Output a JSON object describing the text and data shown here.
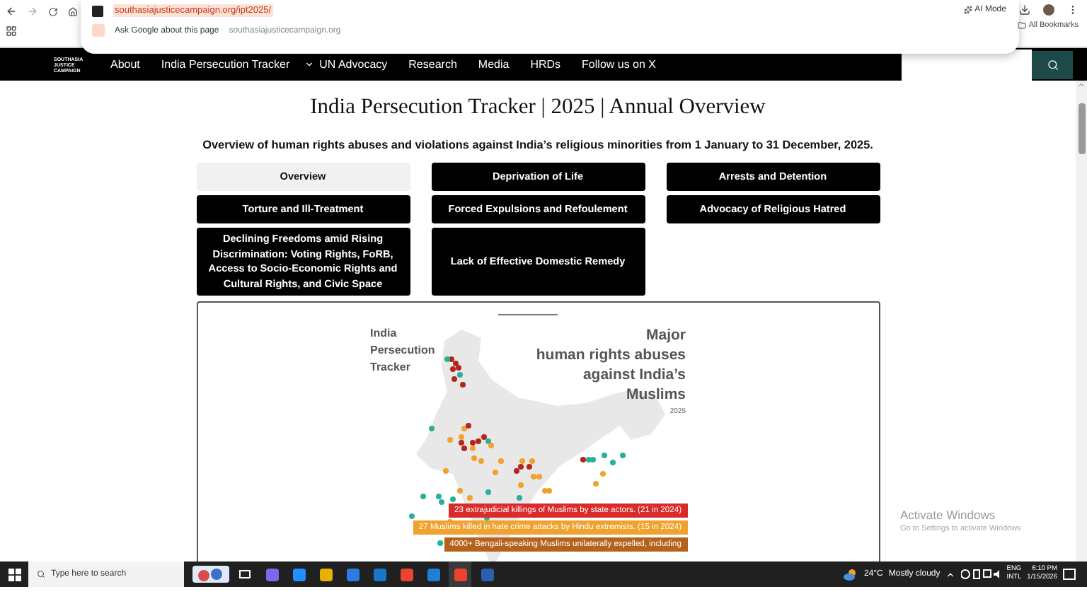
{
  "browser": {
    "url": "southasiajusticecampaign.org/ipt2025/",
    "suggestion": "Ask Google about this page",
    "suggestion_site": "southasiajusticecampaign.org",
    "ai_mode": "AI Mode",
    "bookmarks": "All Bookmarks"
  },
  "nav": {
    "logo_lines": [
      "SOUTHASIA",
      "JUSTICE",
      "CAMPAIGN"
    ],
    "items": [
      {
        "label": "About",
        "has_menu": false
      },
      {
        "label": "India Persecution Tracker",
        "has_menu": true
      },
      {
        "label": "UN Advocacy",
        "has_menu": false
      },
      {
        "label": "Research",
        "has_menu": false
      },
      {
        "label": "Media",
        "has_menu": false
      },
      {
        "label": "HRDs",
        "has_menu": false
      },
      {
        "label": "Follow us on X",
        "has_menu": false
      }
    ]
  },
  "page": {
    "title": "India Persecution Tracker | 2025 | Annual Overview",
    "subtitle": "Overview of human rights abuses and violations against India’s religious minorities from 1 January to 31 December, 2025."
  },
  "tabs": [
    {
      "label": "Overview",
      "selected": true
    },
    {
      "label": "Deprivation of Life",
      "selected": false
    },
    {
      "label": "Arrests and Detention",
      "selected": false
    },
    {
      "label": "Torture and Ill-Treatment",
      "selected": false
    },
    {
      "label": "Forced Expulsions and Refoulement",
      "selected": false
    },
    {
      "label": "Advocacy of Religious Hatred",
      "selected": false
    },
    {
      "label": "Declining Freedoms amid Rising Discrimination: Voting Rights, FoRB, Access to Socio-Economic Rights and Cultural Rights, and Civic Space",
      "selected": false
    },
    {
      "label": "Lack of Effective Domestic Remedy",
      "selected": false
    }
  ],
  "infographic": {
    "title_lines": [
      "India",
      "Persecution",
      "Tracker"
    ],
    "heading_lines": [
      "Major",
      "human rights abuses",
      "against India’s",
      "Muslims"
    ],
    "year": "2025",
    "labels": [
      {
        "text": "23 extrajudicial killings of Muslims by state actors. (21 in 2024)",
        "color": "#d92b2b"
      },
      {
        "text": "27 Muslims killed in hate crime attacks by Hindu extremists. (15 in 2024)",
        "color": "#f0a22e"
      },
      {
        "text": "4000+ Bengali-speaking Muslims unilaterally expelled, including",
        "color": "#b5621c"
      }
    ]
  },
  "activation": {
    "title": "Activate Windows",
    "hint": "Go to Settings to activate Windows"
  },
  "taskbar": {
    "search_placeholder": "Type here to search",
    "temperature": "24°C",
    "weather": "Mostly cloudy",
    "lang": "ENG",
    "layout": "INTL",
    "time": "6:10 PM",
    "date": "1/15/2026"
  }
}
